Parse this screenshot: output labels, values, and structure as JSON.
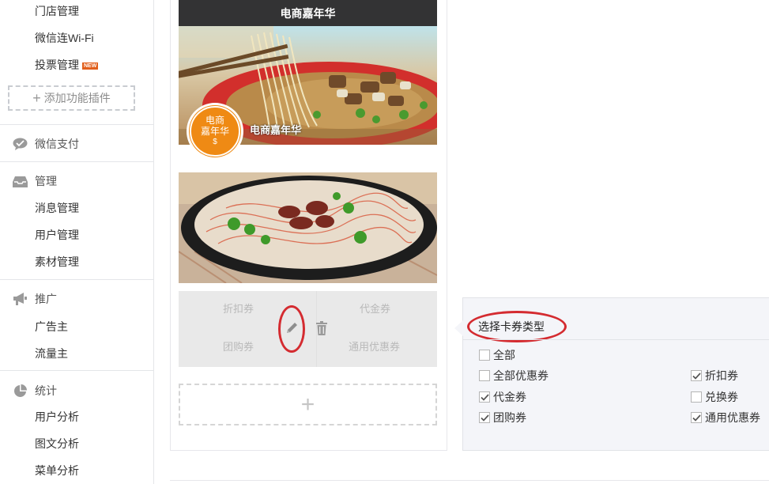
{
  "sidebar": {
    "items_top": [
      {
        "label": "门店管理"
      },
      {
        "label": "微信连Wi-Fi"
      },
      {
        "label": "投票管理",
        "badge": "NEW"
      }
    ],
    "add_plugin_label": "添加功能插件",
    "sections": {
      "pay": {
        "label": "微信支付",
        "icon": "wechat-pay-icon"
      },
      "manage": {
        "label": "管理",
        "icon": "inbox-icon",
        "items": [
          "消息管理",
          "用户管理",
          "素材管理"
        ]
      },
      "promo": {
        "label": "推广",
        "icon": "megaphone-icon",
        "items": [
          "广告主",
          "流量主"
        ]
      },
      "stats": {
        "label": "统计",
        "icon": "pie-chart-icon",
        "items": [
          "用户分析",
          "图文分析",
          "菜单分析"
        ]
      }
    }
  },
  "preview": {
    "header_title": "电商嘉年华",
    "banner_caption": "电商嘉年华",
    "logo_text": [
      "电商",
      "嘉年华"
    ],
    "coupon_labels": [
      "折扣券",
      "代金券",
      "团购券",
      "通用优惠券"
    ],
    "edit_icon": "pencil-icon",
    "delete_icon": "trash-icon",
    "add_icon": "plus-icon"
  },
  "panel": {
    "title": "选择卡券类型",
    "options": {
      "all": {
        "label": "全部",
        "checked": false
      },
      "all_coupons": {
        "label": "全部优惠券",
        "checked": false
      },
      "discount": {
        "label": "折扣券",
        "checked": true
      },
      "cash": {
        "label": "代金券",
        "checked": true
      },
      "exchange": {
        "label": "兑换券",
        "checked": false
      },
      "group": {
        "label": "团购券",
        "checked": true
      },
      "general": {
        "label": "通用优惠券",
        "checked": true
      }
    }
  },
  "colors": {
    "header_bg": "#333334",
    "highlight_red": "#d42b30",
    "badge_orange": "#e15f1c"
  }
}
